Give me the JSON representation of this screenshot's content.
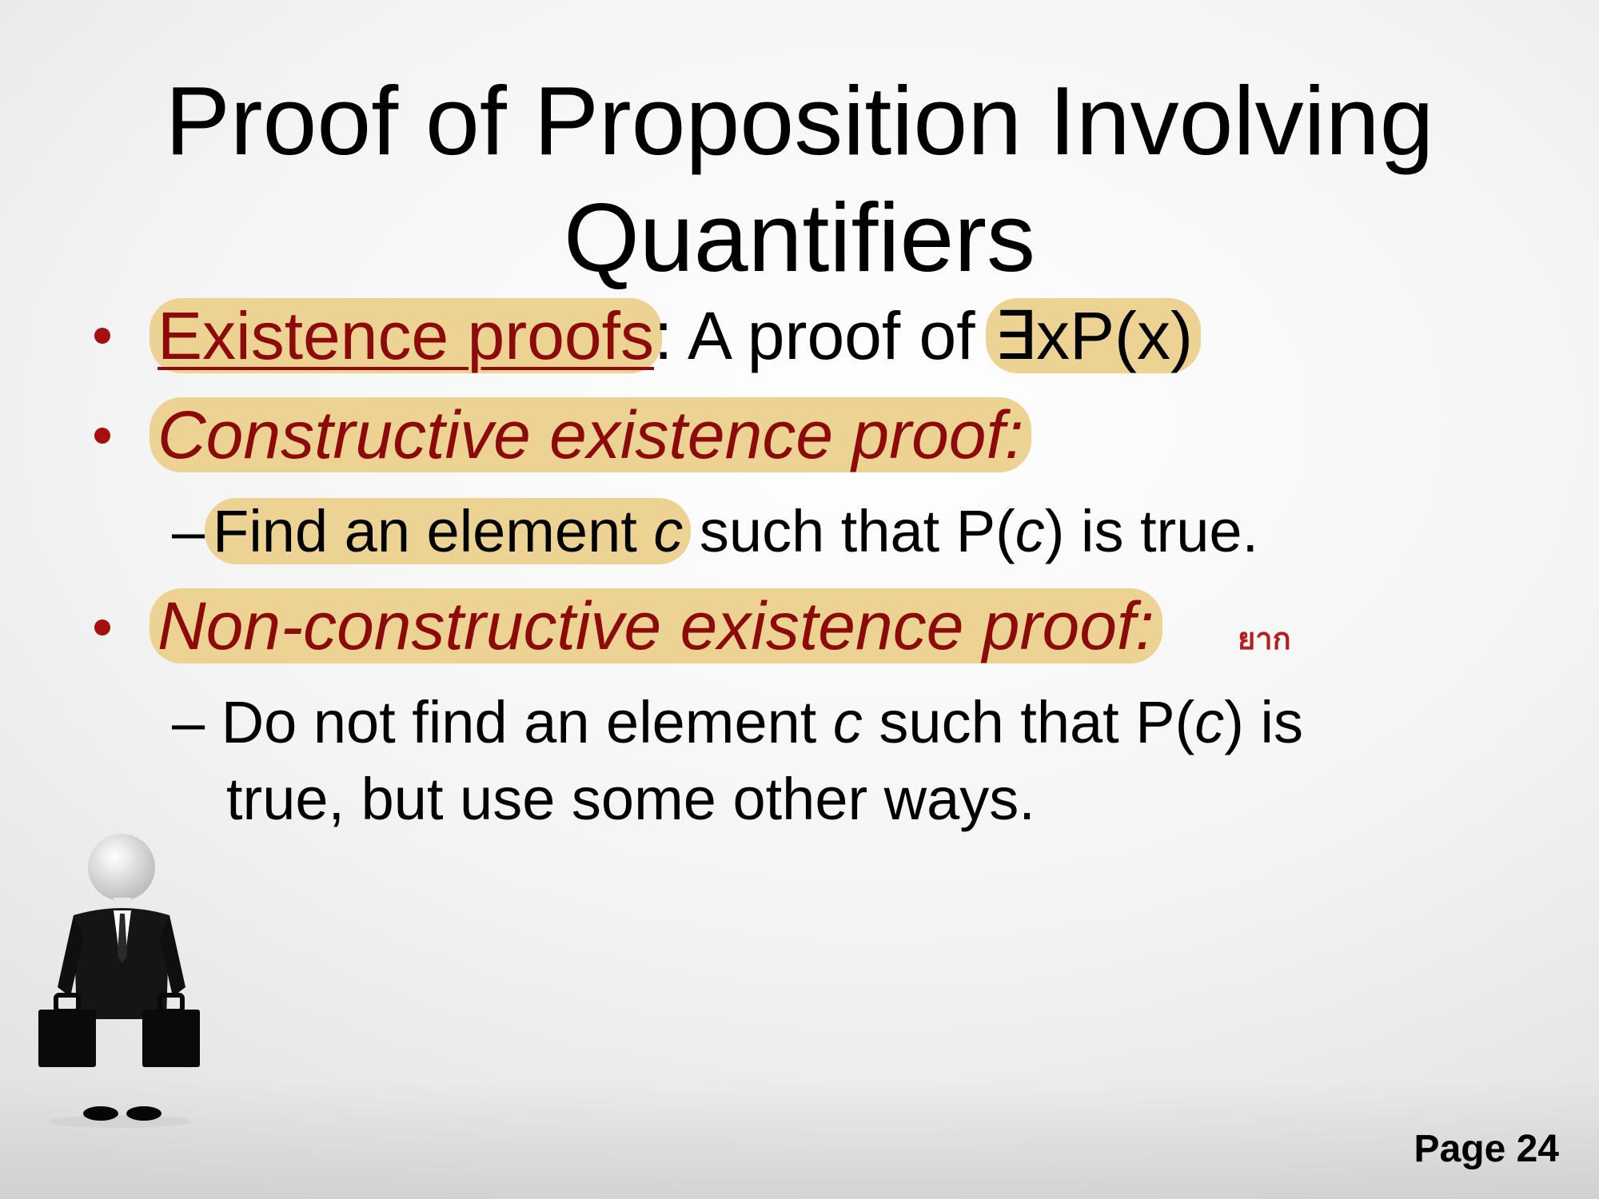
{
  "slide": {
    "title_line1": "Proof of Proposition Involving",
    "title_line2": "Quantifiers",
    "bullet1": {
      "term": "Existence proofs",
      "text": ": A proof of ",
      "formula": "∃xP(x)"
    },
    "bullet2": {
      "term": "Constructive existence proof:"
    },
    "sub1": {
      "dash": "–",
      "highlight_text": "Find an element ",
      "var": "c",
      "rest1": " such that P(",
      "var2": "c",
      "rest2": ") is true."
    },
    "bullet3": {
      "term": "Non-constructive existence proof:",
      "annotation": "ยาก"
    },
    "sub2": {
      "dash": "–",
      "text1": "Do not find an element ",
      "var": "c",
      "text2": " such that P(",
      "var2": "c",
      "text3": ") is",
      "line2": "true, but use some other ways."
    },
    "page_label": "Page 24"
  },
  "colors": {
    "highlight": "#ecd394",
    "term_red": "#8c0a0a",
    "bullet_red": "#a50f0f"
  },
  "icons": {
    "figure": "businessman-with-briefcases-illustration"
  }
}
